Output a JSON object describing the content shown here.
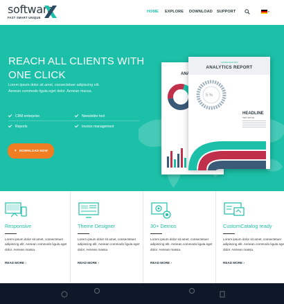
{
  "header": {
    "logo_text": "software",
    "logo_tagline": "FAST SMART UNIQUE",
    "nav": [
      {
        "label": "HOME",
        "active": true
      },
      {
        "label": "EXPLORE",
        "active": false
      },
      {
        "label": "DOWNLOAD",
        "active": false
      },
      {
        "label": "SUPPORT",
        "active": false
      }
    ],
    "search_icon": "search-icon",
    "language_flag": "germany-flag-icon"
  },
  "hero": {
    "title_line1": "REACH ALL CLIENTS WITH",
    "title_line2": "ONE CLICK",
    "text": "Lorem ipsum dolor sit amet, consectetuer adipiscing elit. Aenean commodo ligula eget dolor. Aenean massa.",
    "features": [
      "CRM enterprise",
      "Newsletter tool",
      "Reports",
      "Invoice management"
    ],
    "download_label": "DOWNLOAD NOW",
    "report": {
      "edition": "LIMITED EDITION",
      "title": "ANALYTICS REPORT",
      "back_title": "ANA",
      "gauge_label": "5 %",
      "headline": "HEADLINE",
      "sub": "TEXT OPTION"
    }
  },
  "cards": [
    {
      "title": "Responsive",
      "icon": "responsive-devices-icon",
      "text": "Lorem ipsum dolor sit amet, consectetuer adipiscing elit. Aenean commodo ligula eget dolor. Aenean massa.",
      "more": "READ MORE"
    },
    {
      "title": "Theme Designer",
      "icon": "monitor-design-icon",
      "text": "Lorem ipsum dolor sit amet, consectetuer adipiscing elit. Aenean commodo ligula eget dolor. Aenean massa.",
      "more": "READ MORE"
    },
    {
      "title": "30+ Demos",
      "icon": "demo-settings-icon",
      "text": "Lorem ipsum dolor sit amet, consectetuer adipiscing elit. Aenean commodo ligula eget dolor. Aenean massa.",
      "more": "READ MORE"
    },
    {
      "title": "CustomCatalog ready",
      "icon": "catalog-screens-icon",
      "text": "Lorem ipsum dolor sit amet, consectetuer adipiscing elit. Aenean commodo ligula eget dolor. Aenean massa.",
      "more": "READ MORE"
    }
  ],
  "colors": {
    "accent": "#1cbfa7",
    "button": "#f07d21",
    "footer": "#0f1828",
    "logo_mark_teal": "#1cbfa7",
    "logo_mark_navy": "#2b4a63"
  }
}
